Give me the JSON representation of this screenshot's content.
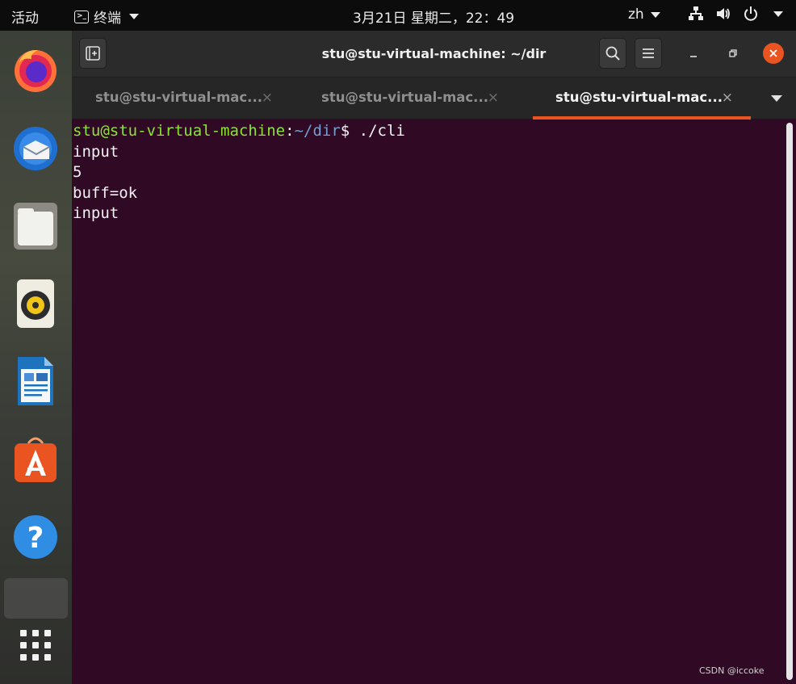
{
  "topbar": {
    "activities": "活动",
    "app_menu": "终端",
    "clock": "3月21日 星期二，22：49",
    "language": "zh"
  },
  "dock": {
    "apps": [
      {
        "name": "Firefox",
        "icon": "firefox-icon"
      },
      {
        "name": "Thunderbird",
        "icon": "thunderbird-icon"
      },
      {
        "name": "Files",
        "icon": "files-icon"
      },
      {
        "name": "Rhythmbox",
        "icon": "rhythmbox-icon"
      },
      {
        "name": "LibreOffice Writer",
        "icon": "writer-icon"
      },
      {
        "name": "Ubuntu Software",
        "icon": "software-icon"
      },
      {
        "name": "Help",
        "icon": "help-icon"
      }
    ],
    "show_apps_icon": "grid-icon"
  },
  "window": {
    "title": "stu@stu-virtual-machine: ~/dir",
    "tabs": [
      {
        "label": "stu@stu-virtual-mac...",
        "active": false
      },
      {
        "label": "stu@stu-virtual-mac...",
        "active": false
      },
      {
        "label": "stu@stu-virtual-mac...",
        "active": true
      }
    ],
    "close_glyph": "×"
  },
  "terminal": {
    "prompt_user": "stu@stu-virtual-machine",
    "prompt_sep": ":",
    "prompt_path": "~/dir",
    "prompt_symbol": "$",
    "command": " ./cli",
    "output": [
      "input",
      "5",
      "buff=ok",
      "input"
    ]
  },
  "watermark": "CSDN @iccoke",
  "colors": {
    "terminal_bg": "#300a24",
    "accent": "#e95420",
    "prompt_user": "#8ae234",
    "prompt_path": "#729fcf"
  }
}
